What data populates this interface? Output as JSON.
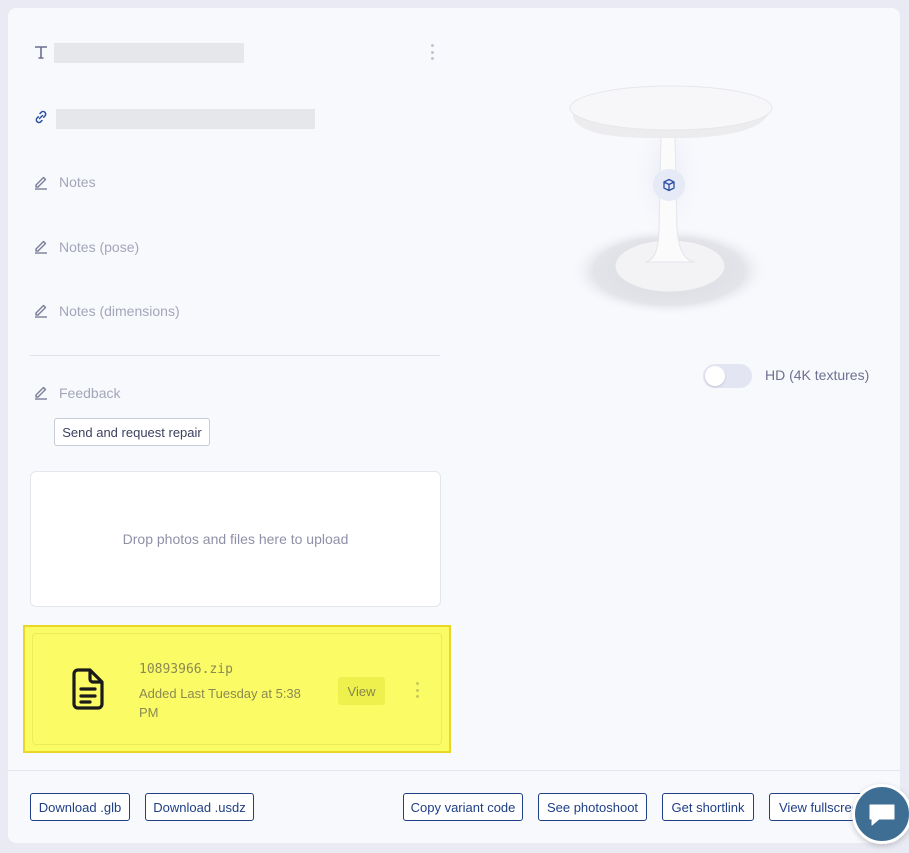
{
  "fields": {
    "notes": "Notes",
    "notes_pose": "Notes (pose)",
    "notes_dimensions": "Notes (dimensions)",
    "feedback": "Feedback"
  },
  "buttons": {
    "send_repair": "Send and request repair",
    "view": "View",
    "download_glb": "Download .glb",
    "download_usdz": "Download .usdz",
    "copy_variant": "Copy variant code",
    "see_photoshoot": "See photoshoot",
    "get_shortlink": "Get shortlink",
    "view_fullscreen": "View fullscreen"
  },
  "dropzone": {
    "text": "Drop photos and files here to upload"
  },
  "file": {
    "name": "10893966.zip",
    "added": "Added Last Tuesday at 5:38 PM"
  },
  "viewer": {
    "hd_label": "HD (4K textures)",
    "hd_enabled": false
  },
  "icons": [
    "text-icon",
    "link-icon",
    "pencil-icon",
    "document-icon",
    "cube-icon",
    "chat-icon",
    "more-vertical-icon"
  ],
  "colors": {
    "accent": "#1f3f86",
    "highlight": "#fbfb66",
    "chat": "#3e6e94"
  }
}
